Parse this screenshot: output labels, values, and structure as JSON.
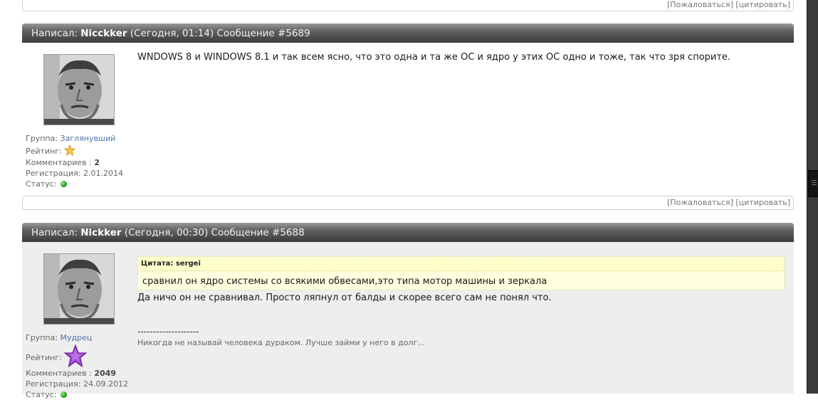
{
  "top_actions": {
    "complain": "[Пожаловаться]",
    "quote": "[цитировать]"
  },
  "posts": [
    {
      "header": {
        "prefix": "Написал:",
        "author": "Nicckker",
        "time": "(Сегодня, 01:14)",
        "message": "Сообщение #5689"
      },
      "author_info": {
        "group_label": "Группа:",
        "group_value": "Заглянувший",
        "rating_label": "Рейтинг:",
        "rating_icon": "gold-star-icon",
        "comments_label": "Комментариев :",
        "comments_value": "2",
        "registration_label": "Регистрация:",
        "registration_value": "2.01.2014",
        "status_label": "Статус:",
        "status_icon": "online-dot-icon"
      },
      "text": "WNDOWS 8 и WINDOWS 8.1 и так всем ясно, что это одна и та же ОС и ядро у этих ОС одно и тоже, так что зря спорите.",
      "actions": {
        "complain": "[Пожаловаться]",
        "quote": "[цитировать]"
      }
    },
    {
      "header": {
        "prefix": "Написал:",
        "author": "Nickker",
        "time": "(Сегодня, 00:30)",
        "message": "Сообщение #5688"
      },
      "author_info": {
        "group_label": "Группа:",
        "group_value": "Мудрец",
        "rating_label": "Рейтинг:",
        "rating_icon": "purple-star-icon",
        "comments_label": "Комментариев :",
        "comments_value": "2049",
        "registration_label": "Регистрация:",
        "registration_value": "24.09.2012",
        "status_label": "Статус:",
        "status_icon": "online-dot-icon"
      },
      "quote": {
        "title": "Цитата: sergei",
        "text": "сравнил он ядро системы со всякими обвесами,это типа мотор машины и зеркала"
      },
      "text": "Да ничо он не сравнивал. Просто ляпнул от балды и скорее всего сам не понял что.",
      "signature_separator": "--------------------",
      "signature": "Никогда не называй человека дураком. Лучше займи у него в долг..."
    }
  ],
  "colors": {
    "header_dark": "#3b3b3b",
    "link_blue": "#4a74a8",
    "quote_bg": "#ffffe0",
    "post_grey": "#eeeeee"
  }
}
